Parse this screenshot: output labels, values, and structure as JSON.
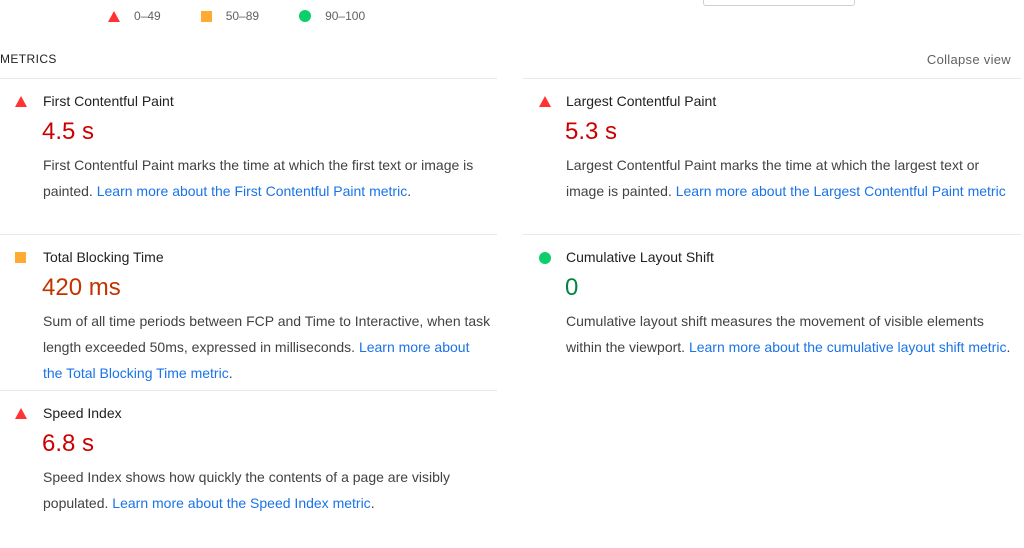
{
  "legend": {
    "fail_range": "0–49",
    "average_range": "50–89",
    "pass_range": "90–100"
  },
  "header": {
    "title": "METRICS",
    "collapse_label": "Collapse view"
  },
  "metrics": {
    "fcp": {
      "status": "fail",
      "name": "First Contentful Paint",
      "value": "4.5 s",
      "desc": "First Contentful Paint marks the time at which the first text or image is painted.",
      "link": "Learn more about the First Contentful Paint metric"
    },
    "lcp": {
      "status": "fail",
      "name": "Largest Contentful Paint",
      "value": "5.3 s",
      "desc": "Largest Contentful Paint marks the time at which the largest text or image is painted.",
      "link": "Learn more about the Largest Contentful Paint metric"
    },
    "tbt": {
      "status": "average",
      "name": "Total Blocking Time",
      "value": "420 ms",
      "desc": "Sum of all time periods between FCP and Time to Interactive, when task length exceeded 50ms, expressed in milliseconds.",
      "link": "Learn more about the Total Blocking Time metric"
    },
    "cls": {
      "status": "pass",
      "name": "Cumulative Layout Shift",
      "value": "0",
      "desc": "Cumulative layout shift measures the movement of visible elements within the viewport.",
      "link": "Learn more about the cumulative layout shift metric"
    },
    "si": {
      "status": "fail",
      "name": "Speed Index",
      "value": "6.8 s",
      "desc": "Speed Index shows how quickly the contents of a page are visibly populated.",
      "link": "Learn more about the Speed Index metric"
    }
  },
  "colors": {
    "fail": "#ff3333",
    "average": "#ffaa33",
    "pass": "#0cce6b",
    "fail_text": "#cc0000",
    "average_text": "#c33300",
    "pass_text": "#018642",
    "link": "#1a73e8"
  },
  "icons": {
    "fail": "triangle-icon",
    "average": "square-icon",
    "pass": "circle-icon"
  }
}
